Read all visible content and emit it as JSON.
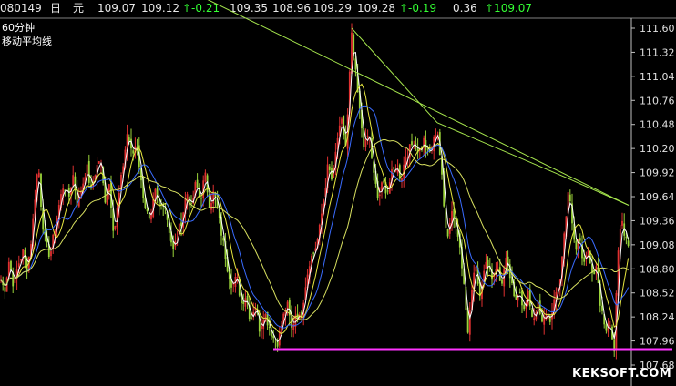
{
  "header": {
    "code": "080149",
    "period": "日",
    "currency": "元",
    "fields": [
      {
        "text": "109.07",
        "color": "#e8e8e8"
      },
      {
        "text": "109.12",
        "color": "#e8e8e8"
      },
      {
        "text": "↑-0.21",
        "color": "#33ff33"
      },
      {
        "text": "109.35",
        "color": "#e8e8e8"
      },
      {
        "text": "108.96",
        "color": "#e8e8e8"
      },
      {
        "text": "109.29",
        "color": "#e8e8e8"
      },
      {
        "text": "109.28",
        "color": "#e8e8e8"
      },
      {
        "text": "↑-0.19",
        "color": "#33ff33"
      },
      {
        "text": "0.36",
        "color": "#e8e8e8"
      },
      {
        "text": "↑109.07",
        "color": "#33ff33"
      }
    ]
  },
  "panel": {
    "timeframe": "60分钟",
    "indicator": "移动平均线"
  },
  "watermark": "KEKSOFT.COM",
  "colors": {
    "up_candle": "#e03030",
    "down_candle": "#9bd43a",
    "ma_short": "#ffffff",
    "ma_mid": "#e8e840",
    "ma_long": "#3a6cff",
    "ma_longest": "#d8e060",
    "trendline": "#a6e64d",
    "support_line": "#ff33ff"
  },
  "chart_data": {
    "type": "candlestick",
    "y_axis_ticks": [
      "111.60",
      "111.32",
      "111.04",
      "110.76",
      "110.48",
      "110.20",
      "109.92",
      "109.64",
      "109.36",
      "109.08",
      "108.80",
      "108.52",
      "108.24",
      "107.96",
      "107.68"
    ],
    "ylim": [
      107.68,
      111.6
    ],
    "price_path": [
      [
        0,
        108.7
      ],
      [
        5,
        108.55
      ],
      [
        10,
        108.9
      ],
      [
        15,
        108.6
      ],
      [
        20,
        108.85
      ],
      [
        25,
        109.0
      ],
      [
        30,
        108.8
      ],
      [
        35,
        109.2
      ],
      [
        38,
        109.6
      ],
      [
        42,
        110.05
      ],
      [
        46,
        109.4
      ],
      [
        50,
        109.1
      ],
      [
        55,
        108.95
      ],
      [
        60,
        109.25
      ],
      [
        65,
        109.55
      ],
      [
        70,
        109.8
      ],
      [
        75,
        109.6
      ],
      [
        80,
        109.9
      ],
      [
        85,
        109.55
      ],
      [
        90,
        109.75
      ],
      [
        95,
        110.0
      ],
      [
        100,
        109.7
      ],
      [
        105,
        109.95
      ],
      [
        110,
        110.1
      ],
      [
        115,
        109.6
      ],
      [
        120,
        109.8
      ],
      [
        125,
        109.2
      ],
      [
        130,
        109.6
      ],
      [
        135,
        110.0
      ],
      [
        140,
        110.4
      ],
      [
        145,
        110.1
      ],
      [
        150,
        110.3
      ],
      [
        155,
        109.8
      ],
      [
        160,
        109.5
      ],
      [
        165,
        109.3
      ],
      [
        170,
        109.7
      ],
      [
        175,
        109.5
      ],
      [
        180,
        109.6
      ],
      [
        185,
        109.3
      ],
      [
        190,
        109.0
      ],
      [
        195,
        109.2
      ],
      [
        200,
        109.4
      ],
      [
        205,
        109.7
      ],
      [
        210,
        109.5
      ],
      [
        215,
        109.8
      ],
      [
        220,
        109.6
      ],
      [
        225,
        109.9
      ],
      [
        230,
        109.55
      ],
      [
        235,
        109.7
      ],
      [
        240,
        109.4
      ],
      [
        245,
        109.1
      ],
      [
        250,
        108.8
      ],
      [
        255,
        108.6
      ],
      [
        260,
        108.7
      ],
      [
        265,
        108.4
      ],
      [
        270,
        108.5
      ],
      [
        275,
        108.2
      ],
      [
        280,
        108.4
      ],
      [
        285,
        108.1
      ],
      [
        290,
        108.3
      ],
      [
        295,
        108.15
      ],
      [
        300,
        108.0
      ],
      [
        305,
        107.95
      ],
      [
        310,
        108.2
      ],
      [
        315,
        108.4
      ],
      [
        320,
        108.1
      ],
      [
        325,
        108.3
      ],
      [
        330,
        108.2
      ],
      [
        335,
        108.6
      ],
      [
        340,
        108.9
      ],
      [
        345,
        109.0
      ],
      [
        350,
        109.2
      ],
      [
        355,
        109.6
      ],
      [
        360,
        110.0
      ],
      [
        365,
        109.8
      ],
      [
        370,
        110.3
      ],
      [
        375,
        110.5
      ],
      [
        380,
        110.2
      ],
      [
        383,
        110.9
      ],
      [
        386,
        111.5
      ],
      [
        390,
        111.1
      ],
      [
        395,
        110.6
      ],
      [
        400,
        110.2
      ],
      [
        405,
        110.4
      ],
      [
        410,
        109.9
      ],
      [
        415,
        109.6
      ],
      [
        420,
        109.8
      ],
      [
        425,
        109.7
      ],
      [
        430,
        109.9
      ],
      [
        435,
        110.0
      ],
      [
        440,
        109.85
      ],
      [
        445,
        110.1
      ],
      [
        450,
        110.2
      ],
      [
        455,
        110.3
      ],
      [
        460,
        110.15
      ],
      [
        465,
        110.3
      ],
      [
        470,
        110.1
      ],
      [
        475,
        110.25
      ],
      [
        480,
        110.45
      ],
      [
        484,
        110.0
      ],
      [
        488,
        109.4
      ],
      [
        492,
        109.2
      ],
      [
        496,
        109.5
      ],
      [
        500,
        109.3
      ],
      [
        505,
        109.1
      ],
      [
        510,
        108.5
      ],
      [
        514,
        108.0
      ],
      [
        518,
        108.6
      ],
      [
        522,
        108.9
      ],
      [
        526,
        108.5
      ],
      [
        530,
        108.7
      ],
      [
        535,
        108.9
      ],
      [
        540,
        108.7
      ],
      [
        545,
        108.85
      ],
      [
        550,
        108.6
      ],
      [
        555,
        108.9
      ],
      [
        560,
        108.7
      ],
      [
        565,
        108.4
      ],
      [
        570,
        108.6
      ],
      [
        575,
        108.3
      ],
      [
        580,
        108.5
      ],
      [
        585,
        108.2
      ],
      [
        590,
        108.4
      ],
      [
        595,
        108.15
      ],
      [
        600,
        108.3
      ],
      [
        605,
        108.2
      ],
      [
        610,
        108.5
      ],
      [
        615,
        108.7
      ],
      [
        620,
        109.3
      ],
      [
        624,
        109.75
      ],
      [
        628,
        109.3
      ],
      [
        632,
        109.0
      ],
      [
        636,
        109.2
      ],
      [
        640,
        108.9
      ],
      [
        645,
        109.0
      ],
      [
        650,
        108.7
      ],
      [
        655,
        108.8
      ],
      [
        660,
        108.3
      ],
      [
        665,
        108.1
      ],
      [
        670,
        108.2
      ],
      [
        674,
        107.8
      ],
      [
        678,
        108.9
      ],
      [
        682,
        109.4
      ],
      [
        686,
        109.2
      ],
      [
        690,
        109.1
      ]
    ],
    "moving_averages": [
      {
        "color_key": "ma_short",
        "smoothing": 3
      },
      {
        "color_key": "ma_mid",
        "smoothing": 8
      },
      {
        "color_key": "ma_long",
        "smoothing": 14
      },
      {
        "color_key": "ma_longest",
        "smoothing": 30
      }
    ],
    "trendlines": [
      {
        "from": [
          215,
          112.0
        ],
        "to": [
          690,
          109.54
        ]
      },
      {
        "from": [
          386,
          111.6
        ],
        "to": [
          480,
          110.5
        ]
      },
      {
        "from": [
          480,
          110.5
        ],
        "to": [
          624,
          109.85
        ]
      },
      {
        "from": [
          624,
          109.85
        ],
        "to": [
          690,
          109.54
        ]
      }
    ],
    "support_line": {
      "from": [
        300,
        107.86
      ],
      "to": [
        738,
        107.86
      ]
    }
  }
}
